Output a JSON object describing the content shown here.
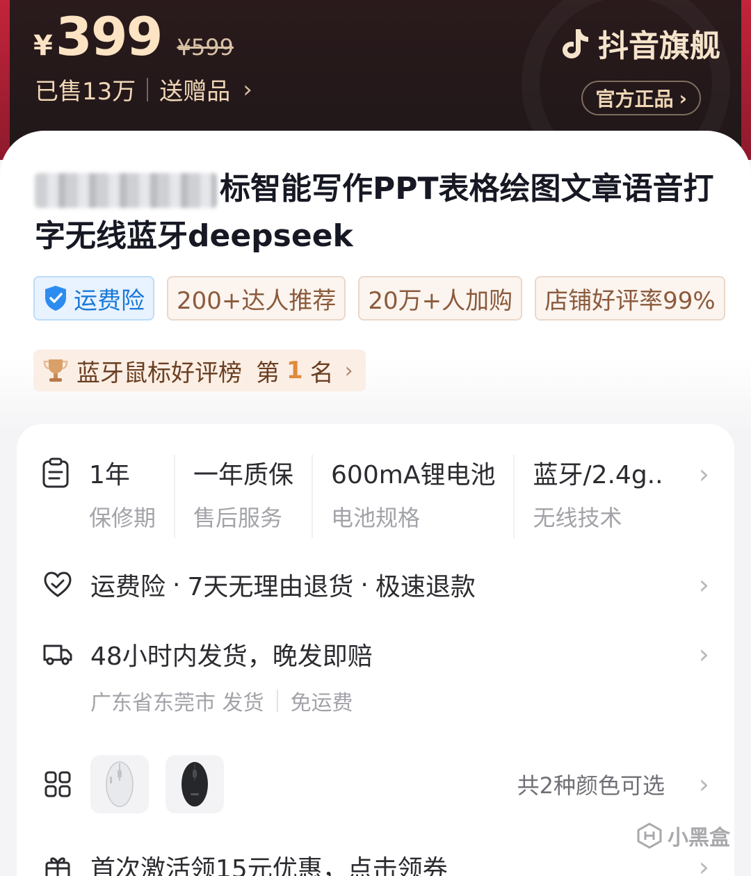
{
  "header": {
    "currency": "¥",
    "price": "399",
    "original_price": "¥599",
    "sold": "已售13万",
    "gift": "送赠品",
    "brand": "抖音旗舰",
    "official": "官方正品"
  },
  "product": {
    "title_visible": "标智能写作PPT表格绘图文章语音打字无线蓝牙deepseek",
    "tags": {
      "insurance": "运费险",
      "t1": "200+达人推荐",
      "t2": "20万+人加购",
      "t3": "店铺好评率99%"
    },
    "rank": {
      "label": "蓝牙鼠标好评榜",
      "prefix": "第",
      "number": "1",
      "suffix": "名"
    }
  },
  "specs": [
    {
      "value": "1年",
      "key": "保修期"
    },
    {
      "value": "一年质保",
      "key": "售后服务"
    },
    {
      "value": "600mA锂电池",
      "key": "电池规格"
    },
    {
      "value": "蓝牙/2.4g..",
      "key": "无线技术"
    }
  ],
  "service": {
    "a": "运费险",
    "b": "7天无理由退货",
    "c": "极速退款",
    "dot": "·"
  },
  "shipping": {
    "main": "48小时内发货，晚发即赔",
    "origin": "广东省东莞市 发货",
    "fee": "免运费"
  },
  "colors": {
    "text": "共2种颜色可选",
    "options": [
      "white-mouse",
      "black-mouse"
    ]
  },
  "coupon": {
    "text": "首次激活领15元优惠，点击领券"
  },
  "watermark": "小黑盒",
  "theme": {
    "header_bg": "#1f1718",
    "gold": "#fbe3c3",
    "accent_red": "#c3243a",
    "tag_blue": "#1a79d8",
    "tag_brown": "#8b5a3c"
  }
}
